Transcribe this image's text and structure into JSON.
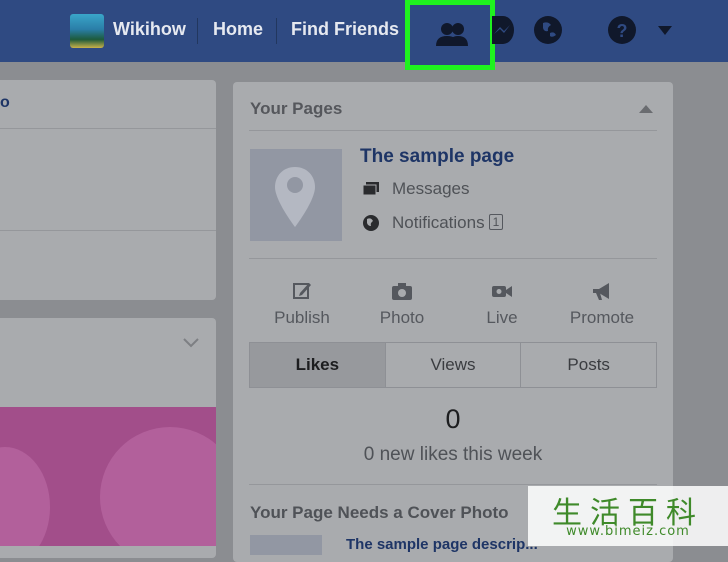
{
  "nav": {
    "profile_name": "Wikihow",
    "home": "Home",
    "find_friends": "Find Friends",
    "icons": [
      "friend-requests-icon",
      "messenger-icon",
      "notifications-globe-icon",
      "help-icon",
      "account-menu-caret-icon"
    ],
    "highlight_color": "#1ff21f"
  },
  "left_panel": {
    "partial_link": "o"
  },
  "your_pages": {
    "title": "Your Pages",
    "page_name": "The sample page",
    "messages": "Messages",
    "notifications": "Notifications",
    "notifications_count": "1",
    "actions": [
      {
        "label": "Publish",
        "icon": "edit-icon"
      },
      {
        "label": "Photo",
        "icon": "camera-icon"
      },
      {
        "label": "Live",
        "icon": "video-icon"
      },
      {
        "label": "Promote",
        "icon": "megaphone-icon"
      }
    ],
    "tabs": [
      "Likes",
      "Views",
      "Posts"
    ],
    "active_tab": "Likes",
    "likes_count": "0",
    "likes_subtext": "0 new likes this week",
    "cover_title": "Your Page Needs a Cover Photo",
    "cover_desc": "The sample page descrip..."
  },
  "watermark": {
    "chinese": "生活百科",
    "url": "www.bimeiz.com"
  }
}
